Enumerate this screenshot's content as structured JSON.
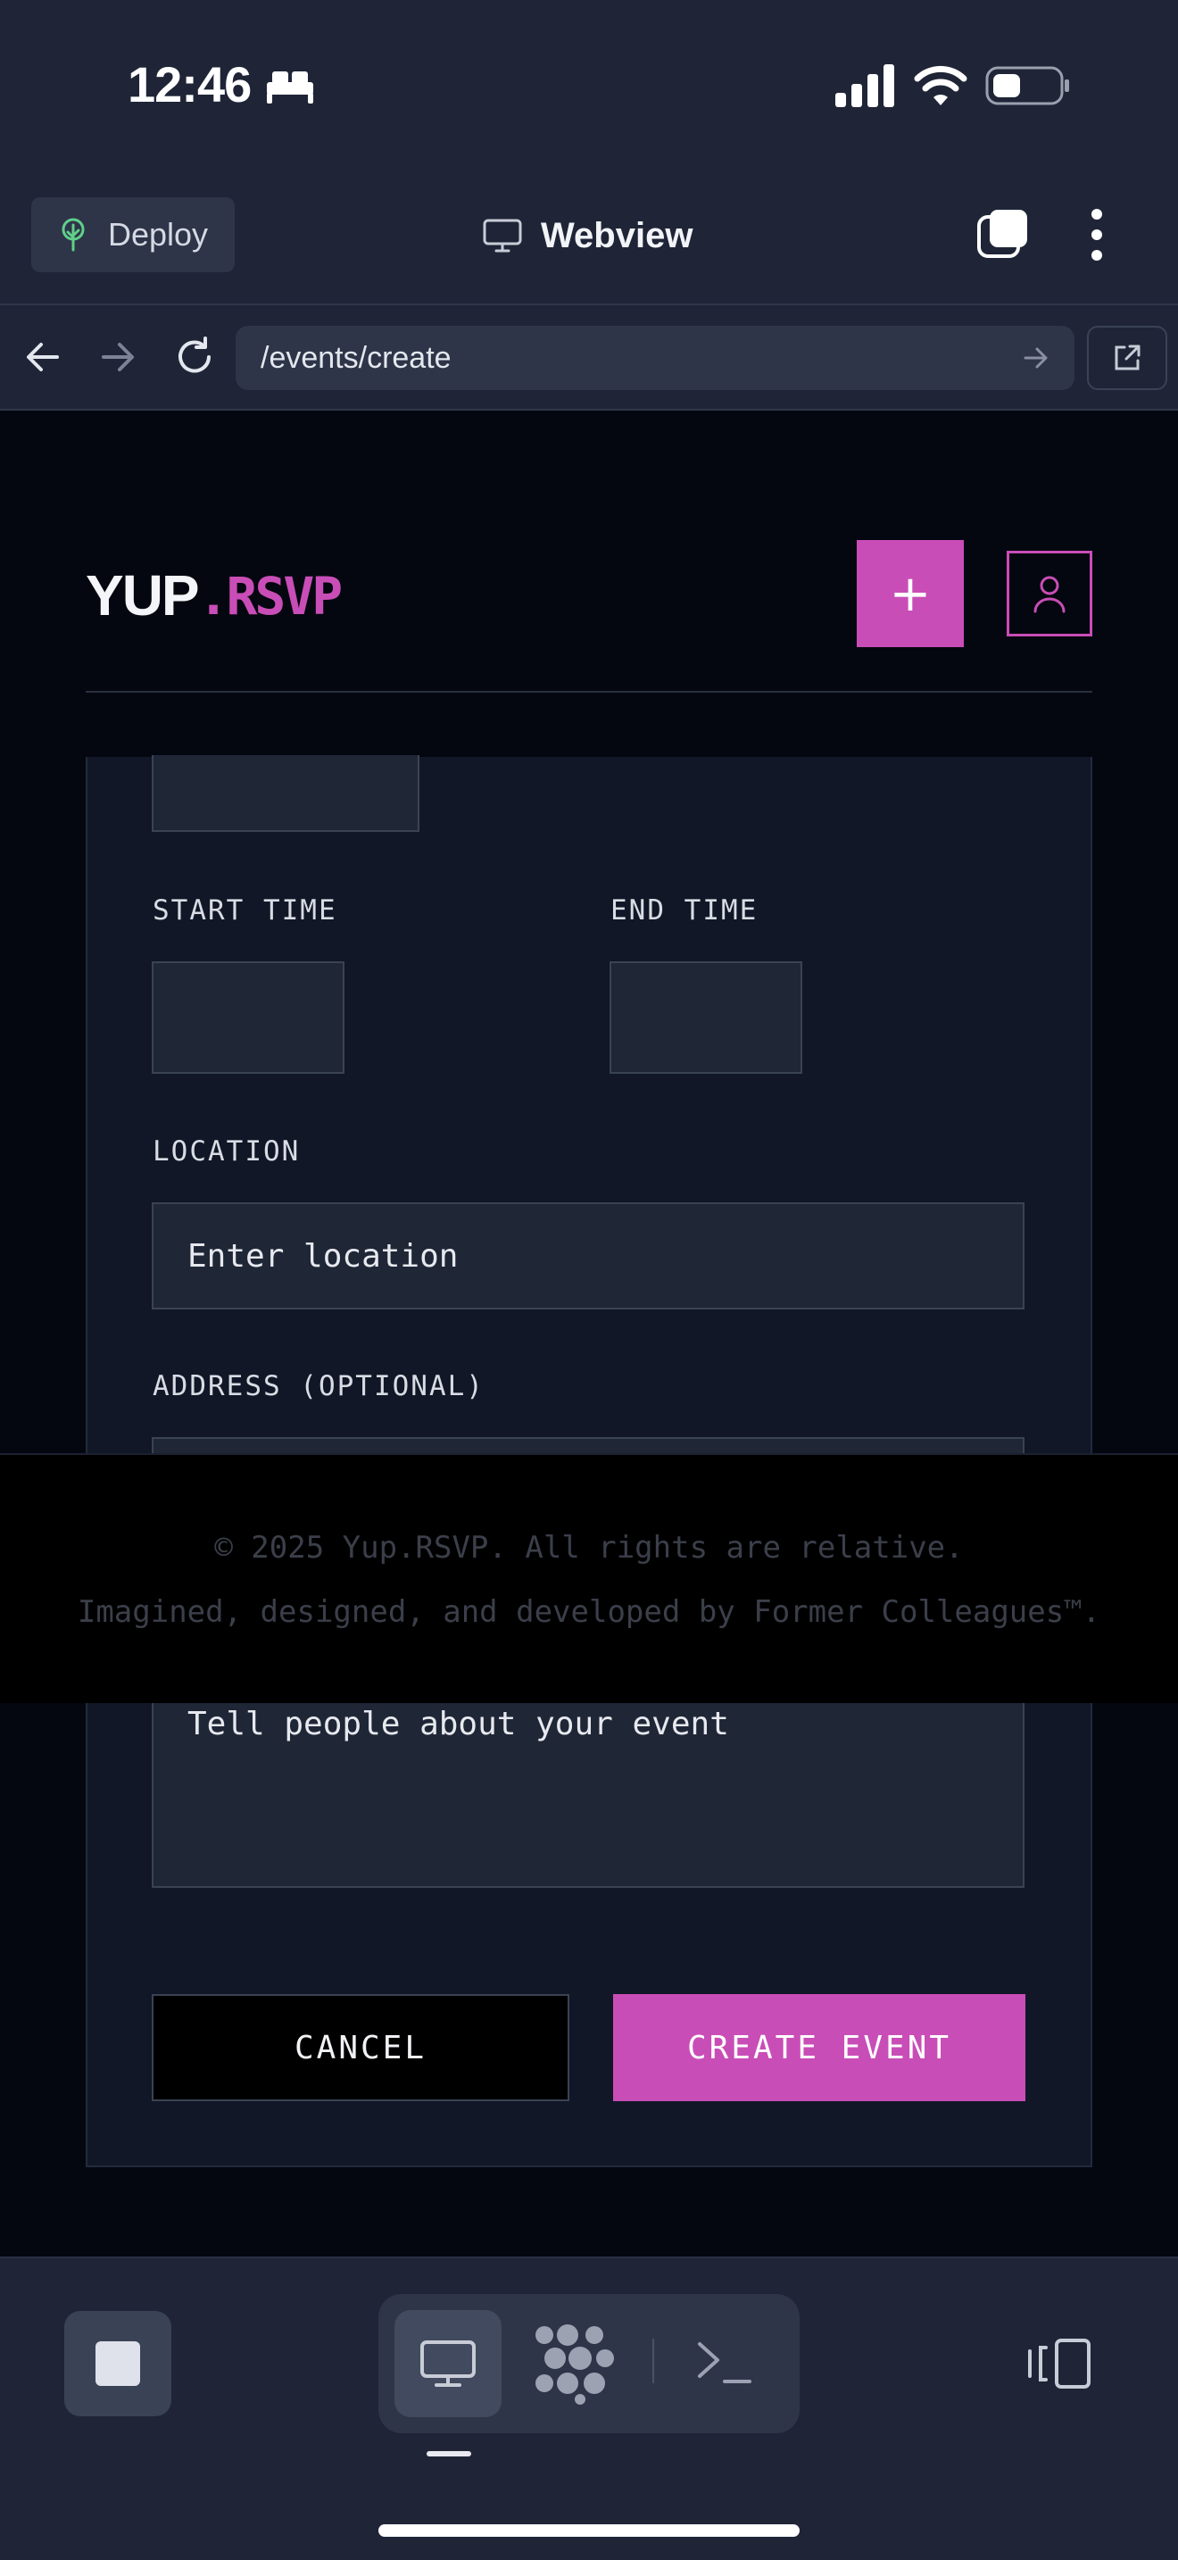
{
  "status_bar": {
    "time": "12:46",
    "icons": [
      "bed-icon",
      "cellular-signal-icon",
      "wifi-icon",
      "battery-icon"
    ]
  },
  "toolbar": {
    "deploy_label": "Deploy",
    "title": "Webview",
    "icons": [
      "tree-icon",
      "monitor-icon",
      "tabs-icon",
      "more-vertical-icon"
    ]
  },
  "url_bar": {
    "url": "/events/create",
    "icons": [
      "back-arrow-icon",
      "forward-arrow-icon",
      "reload-icon",
      "go-arrow-icon",
      "external-link-icon"
    ]
  },
  "site": {
    "logo_part1": "YUP",
    "logo_part2": ".RSVP",
    "create_button": "+",
    "accent_color": "#c94db7"
  },
  "form": {
    "start_time_label": "START TIME",
    "end_time_label": "END TIME",
    "location_label": "LOCATION",
    "location_placeholder": "Enter location",
    "address_label": "ADDRESS (OPTIONAL)",
    "description_placeholder": "Tell people about your event",
    "cancel_label": "CANCEL",
    "create_label": "CREATE EVENT"
  },
  "footer": {
    "copyright": "© 2025 Yup.RSVP. All rights are relative.",
    "credits": "Imagined, designed, and developed by Former Colleagues™."
  },
  "bottom_bar": {
    "icons": [
      "stop-icon",
      "monitor-icon",
      "agent-dots-icon",
      "terminal-icon",
      "side-panel-icon"
    ]
  }
}
